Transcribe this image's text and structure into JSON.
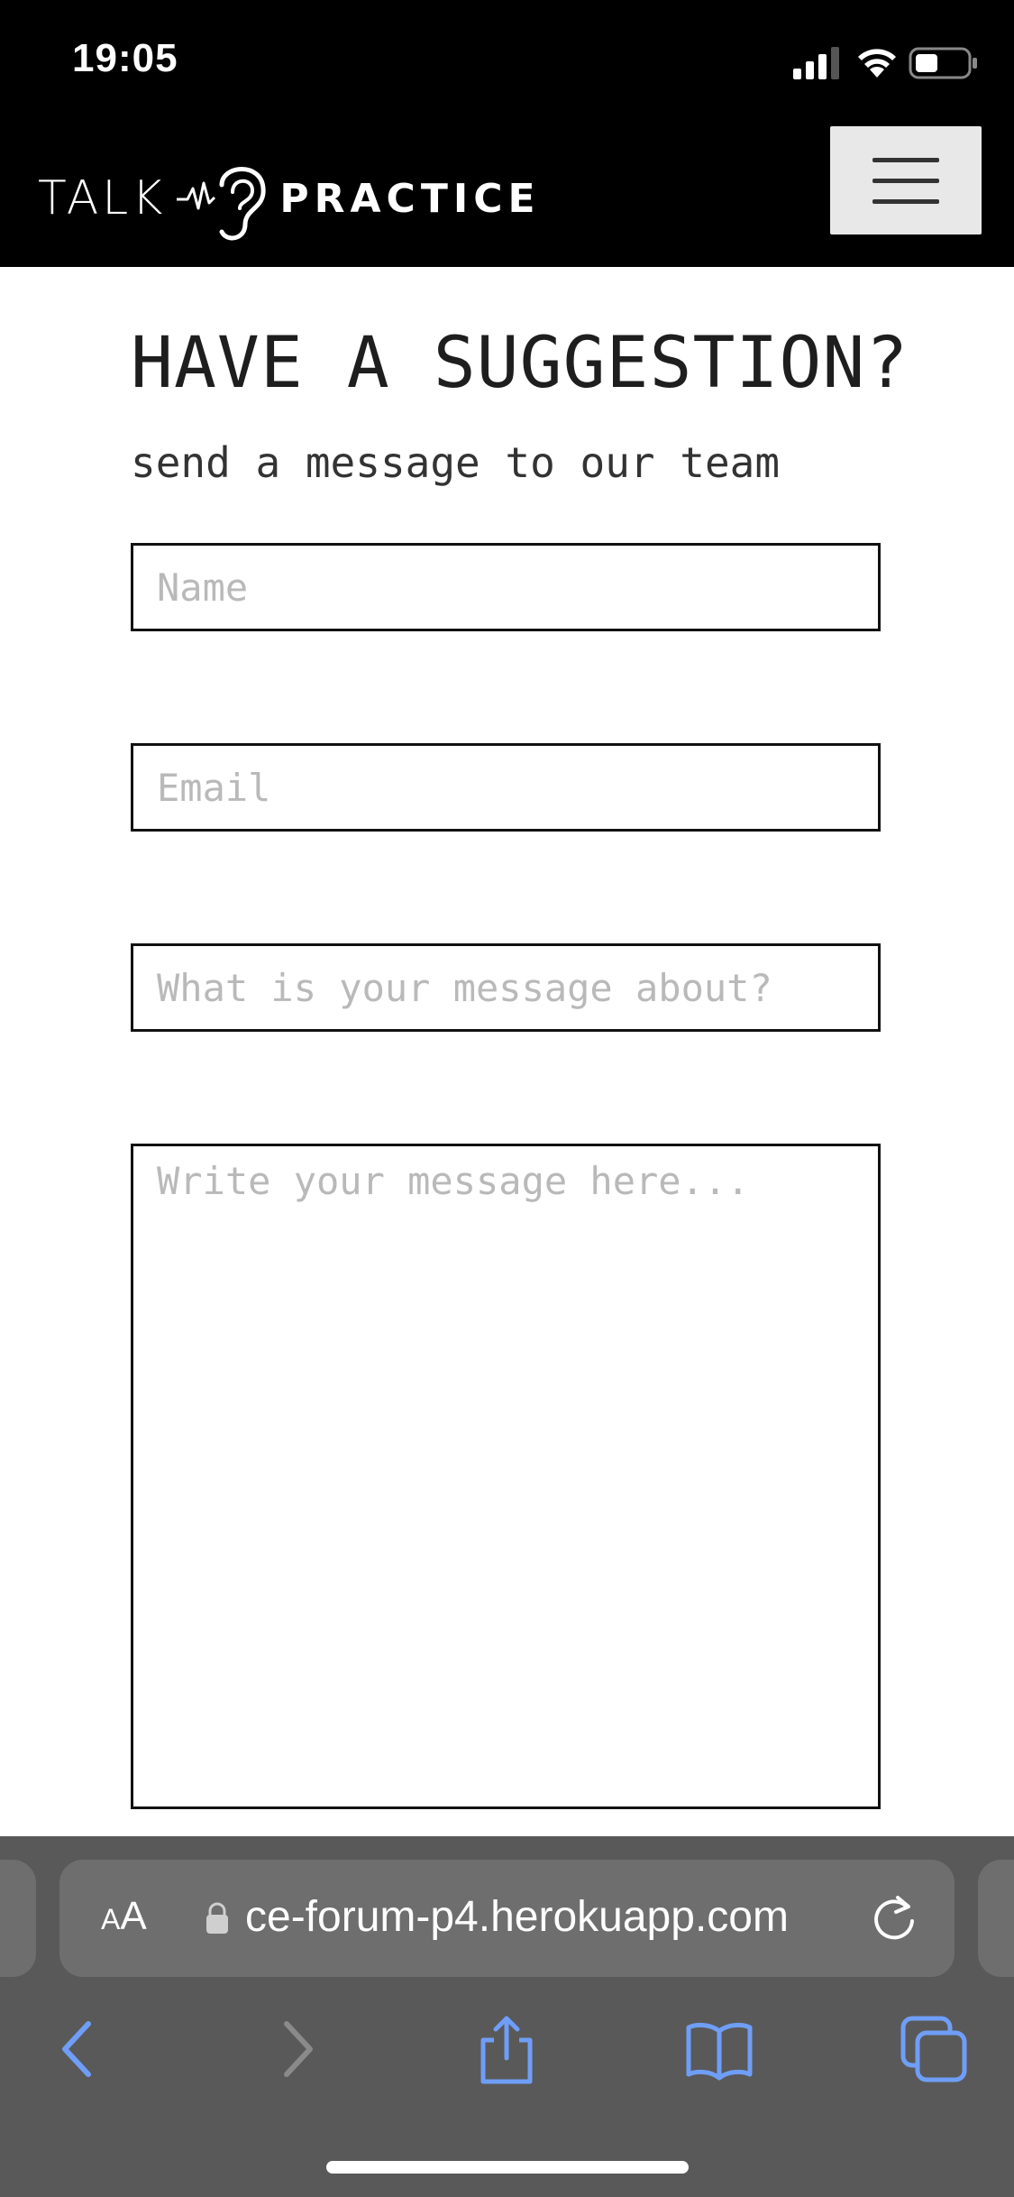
{
  "status_bar": {
    "time": "19:05"
  },
  "brand": {
    "talk": "TALK",
    "practice": "PRACTICE"
  },
  "page": {
    "heading": "HAVE A SUGGESTION?",
    "subheading": "send a message to our team"
  },
  "form": {
    "name": {
      "placeholder": "Name",
      "value": ""
    },
    "email": {
      "placeholder": "Email",
      "value": ""
    },
    "subject": {
      "placeholder": "What is your message about?",
      "value": ""
    },
    "message": {
      "placeholder": "Write your message here...",
      "value": ""
    }
  },
  "browser": {
    "text_size_label_big": "A",
    "text_size_label_small": "A",
    "url": "ce-forum-p4.herokuapp.com"
  },
  "colors": {
    "navbar_bg": "#000000",
    "toggle_bg": "#e8e8e8",
    "safari_chrome": "#595959",
    "safari_accent": "#6f9ef8",
    "placeholder": "#b9b9b9"
  },
  "icons": {
    "menu": "hamburger-icon",
    "logo": "ear-soundwave-icon",
    "back": "chevron-left-icon",
    "forward": "chevron-right-icon",
    "share": "share-icon",
    "bookmarks": "book-icon",
    "tabs": "tabs-icon"
  }
}
